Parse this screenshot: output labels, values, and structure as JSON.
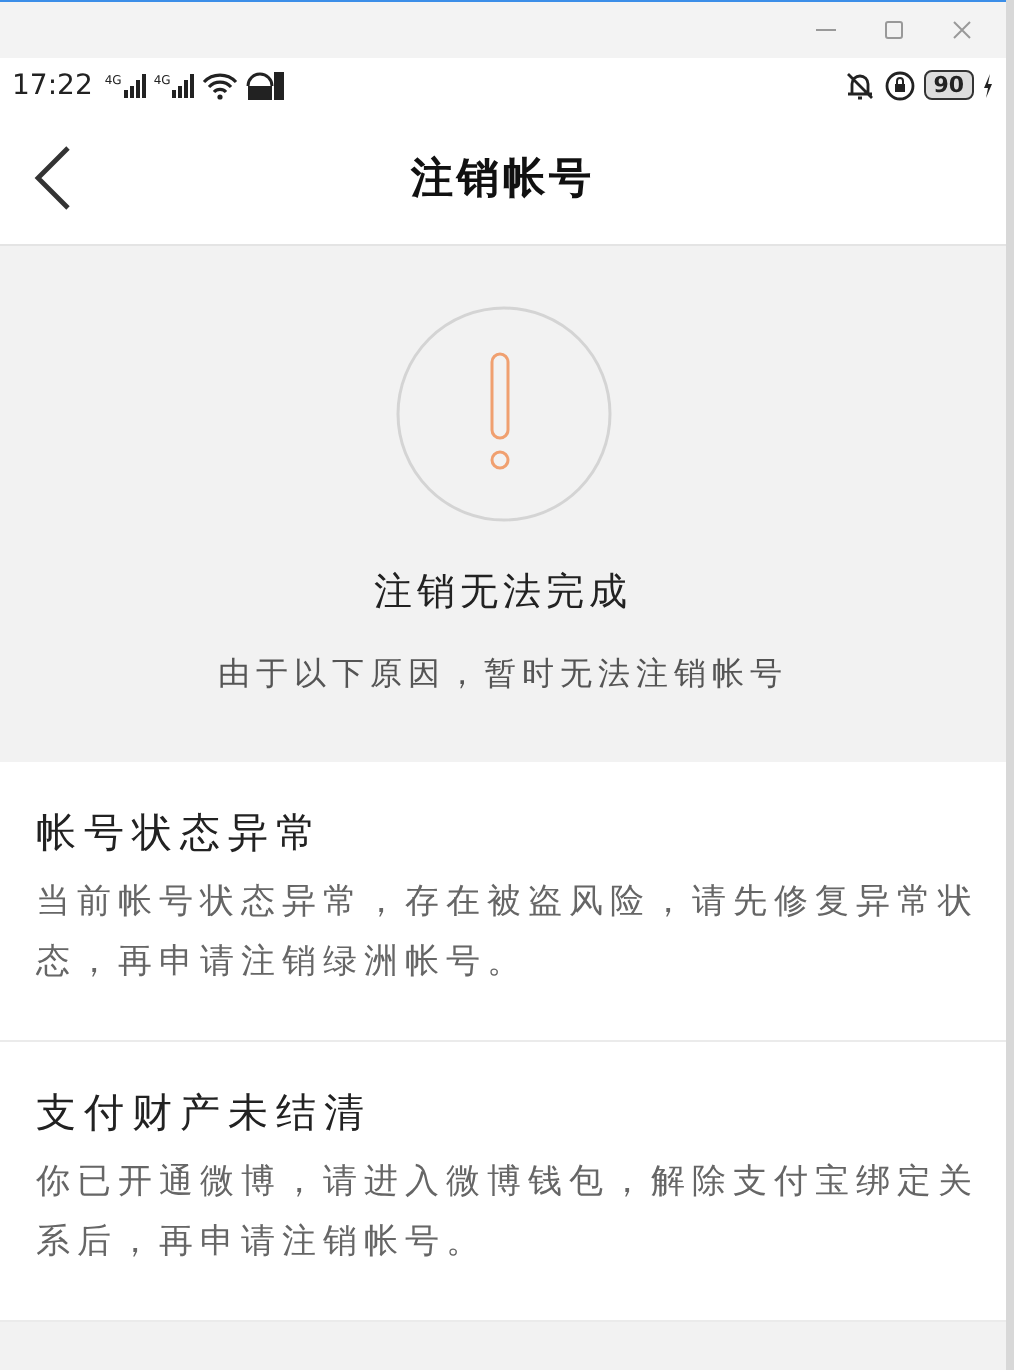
{
  "status_bar": {
    "time": "17:22",
    "signal_labels": [
      "4G",
      "4G"
    ],
    "battery": "90"
  },
  "header": {
    "title": "注销帐号"
  },
  "notice": {
    "title": "注销无法完成",
    "subtitle": "由于以下原因，暂时无法注销帐号"
  },
  "reasons": [
    {
      "title": "帐号状态异常",
      "description": "当前帐号状态异常，存在被盗风险，请先修复异常状态，再申请注销绿洲帐号。"
    },
    {
      "title": "支付财产未结清",
      "description": "你已开通微博，请进入微博钱包，解除支付宝绑定关系后，再申请注销帐号。"
    }
  ]
}
